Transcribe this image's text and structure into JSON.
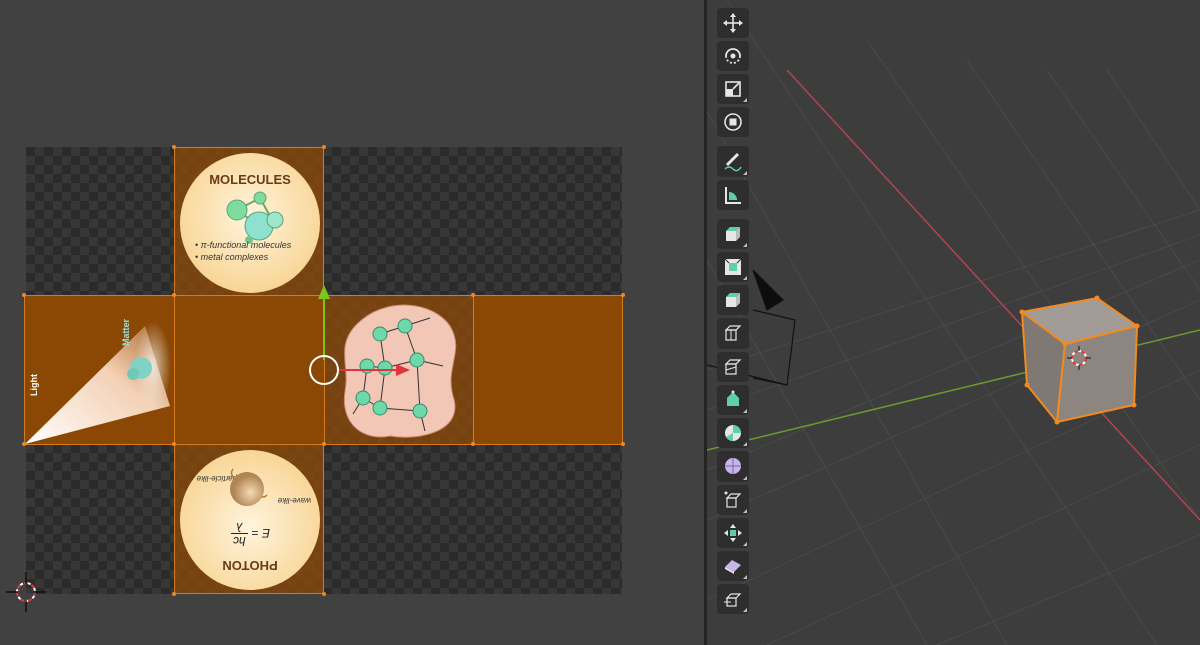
{
  "uv_editor": {
    "faces": {
      "top": {
        "title": "MOLECULES",
        "bullets": [
          "π-functional molecules",
          "metal complexes"
        ]
      },
      "left": {
        "label_light": "Light",
        "label_matter": "Matter"
      },
      "bottom": {
        "title": "PHOTON",
        "formula_lhs": "E =",
        "formula_num": "hc",
        "formula_den": "λ",
        "label_particle": "particle-like",
        "label_wave": "wave-like"
      }
    },
    "gizmo": {
      "x_axis_color": "#e0343e",
      "y_axis_color": "#7cc51a"
    },
    "selection_color": "#d57a1e"
  },
  "toolbar": {
    "tools": [
      {
        "name": "move-tool",
        "icon": "move-arrows-icon"
      },
      {
        "name": "rotate-tool",
        "icon": "rotate-icon"
      },
      {
        "name": "scale-tool",
        "icon": "scale-icon"
      },
      {
        "name": "transform-tool",
        "icon": "transform-icon"
      },
      {
        "name": "annotate-tool",
        "icon": "pencil-icon"
      },
      {
        "name": "measure-tool",
        "icon": "ruler-icon"
      },
      {
        "name": "add-cube-tool",
        "icon": "cube-add-icon"
      },
      {
        "name": "extrude-region-tool",
        "icon": "extrude-icon"
      },
      {
        "name": "inset-faces-tool",
        "icon": "inset-icon"
      },
      {
        "name": "bevel-tool",
        "icon": "bevel-icon"
      },
      {
        "name": "loop-cut-tool",
        "icon": "loop-cut-icon"
      },
      {
        "name": "knife-tool",
        "icon": "knife-icon"
      },
      {
        "name": "poly-build-tool",
        "icon": "poly-build-icon"
      },
      {
        "name": "spin-tool",
        "icon": "spin-icon"
      },
      {
        "name": "smooth-tool",
        "icon": "smooth-sphere-icon"
      },
      {
        "name": "edge-slide-tool",
        "icon": "edge-slide-icon"
      },
      {
        "name": "shrink-fatten-tool",
        "icon": "shrink-fatten-icon"
      },
      {
        "name": "shear-tool",
        "icon": "shear-icon"
      },
      {
        "name": "rip-region-tool",
        "icon": "rip-icon"
      }
    ],
    "accent_color": "#5ecfae"
  },
  "viewport": {
    "grid_color": "#4a4a4a",
    "x_axis_color": "#b0454d",
    "y_axis_color": "#6d9a2f",
    "object_color": "#8c8580",
    "selection_outline": "#f28b1f"
  }
}
